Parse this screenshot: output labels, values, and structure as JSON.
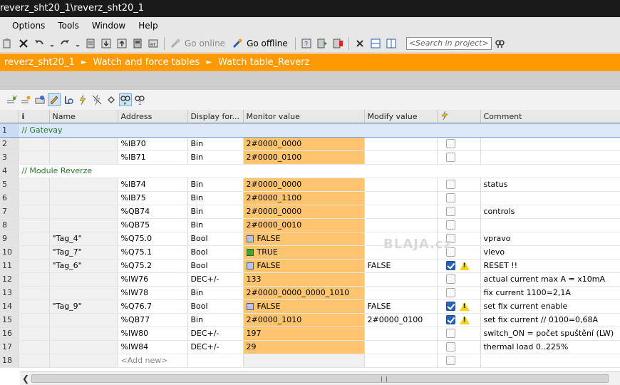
{
  "window": {
    "title": "reverz_sht20_1\\reverz_sht20_1"
  },
  "menu": [
    "Options",
    "Tools",
    "Window",
    "Help"
  ],
  "toolbar": {
    "go_online": "Go online",
    "go_offline": "Go offline",
    "search_placeholder": "<Search in project>"
  },
  "breadcrumb": [
    "reverz_sht20_1",
    "Watch and force tables",
    "Watch table_Reverz"
  ],
  "watermark": "BLAJA.cz",
  "table": {
    "headers": [
      "i",
      "Name",
      "Address",
      "Display for...",
      "Monitor value",
      "Modify value",
      "",
      "Comment"
    ],
    "rows": [
      {
        "n": "1",
        "group": "// Gatevay"
      },
      {
        "n": "2",
        "name": "",
        "address": "%IB70",
        "display": "Bin",
        "monitor": "2#0000_0000",
        "bool": "",
        "modify": "",
        "checked": false,
        "warn": false,
        "comment": ""
      },
      {
        "n": "3",
        "name": "",
        "address": "%IB71",
        "display": "Bin",
        "monitor": "2#0000_0100",
        "bool": "",
        "modify": "",
        "checked": false,
        "warn": false,
        "comment": ""
      },
      {
        "n": "4",
        "group": "// Module Reverze"
      },
      {
        "n": "5",
        "name": "",
        "address": "%IB74",
        "display": "Bin",
        "monitor": "2#0000_0000",
        "bool": "",
        "modify": "",
        "checked": false,
        "warn": false,
        "comment": "status"
      },
      {
        "n": "6",
        "name": "",
        "address": "%IB75",
        "display": "Bin",
        "monitor": "2#0000_1100",
        "bool": "",
        "modify": "",
        "checked": false,
        "warn": false,
        "comment": ""
      },
      {
        "n": "7",
        "name": "",
        "address": "%QB74",
        "display": "Bin",
        "monitor": "2#0000_0000",
        "bool": "",
        "modify": "",
        "checked": false,
        "warn": false,
        "comment": "controls"
      },
      {
        "n": "8",
        "name": "",
        "address": "%QB75",
        "display": "Bin",
        "monitor": "2#0000_0010",
        "bool": "",
        "modify": "",
        "checked": false,
        "warn": false,
        "comment": ""
      },
      {
        "n": "9",
        "name": "\"Tag_4\"",
        "address": "%Q75.0",
        "display": "Bool",
        "monitor": "FALSE",
        "bool": "false",
        "modify": "",
        "checked": false,
        "warn": false,
        "comment": "vpravo"
      },
      {
        "n": "10",
        "name": "\"Tag_7\"",
        "address": "%Q75.1",
        "display": "Bool",
        "monitor": "TRUE",
        "bool": "true",
        "modify": "",
        "checked": false,
        "warn": false,
        "comment": "vlevo"
      },
      {
        "n": "11",
        "name": "\"Tag_6\"",
        "address": "%Q75.2",
        "display": "Bool",
        "monitor": "FALSE",
        "bool": "false",
        "modify": "FALSE",
        "checked": true,
        "warn": true,
        "comment": "RESET !!"
      },
      {
        "n": "12",
        "name": "",
        "address": "%IW76",
        "display": "DEC+/-",
        "monitor": "133",
        "bool": "",
        "modify": "",
        "checked": false,
        "warn": false,
        "comment": "actual current max A = x10mA"
      },
      {
        "n": "13",
        "name": "",
        "address": "%IW78",
        "display": "Bin",
        "monitor": "2#0000_0000_0000_1010",
        "bool": "",
        "modify": "",
        "checked": false,
        "warn": false,
        "comment": "fix current 1100=2,1A"
      },
      {
        "n": "14",
        "name": "\"Tag_9\"",
        "address": "%Q76.7",
        "display": "Bool",
        "monitor": "FALSE",
        "bool": "false",
        "modify": "FALSE",
        "checked": true,
        "warn": true,
        "comment": "set fix current enable"
      },
      {
        "n": "15",
        "name": "",
        "address": "%QB77",
        "display": "Bin",
        "monitor": "2#0000_1010",
        "bool": "",
        "modify": "2#0000_0100",
        "checked": true,
        "warn": true,
        "comment": "set fix current // 0100=0,68A"
      },
      {
        "n": "16",
        "name": "",
        "address": "%IW80",
        "display": "DEC+/-",
        "monitor": "197",
        "bool": "",
        "modify": "",
        "checked": false,
        "warn": false,
        "comment": "switch_ON = počet spuštění (LW)"
      },
      {
        "n": "17",
        "name": "",
        "address": "%IW84",
        "display": "DEC+/-",
        "monitor": "29",
        "bool": "",
        "modify": "",
        "checked": false,
        "warn": false,
        "comment": "thermal load 0..225%"
      },
      {
        "n": "18",
        "name": "",
        "address": "<Add new>",
        "display": "",
        "monitor": "",
        "bool": "",
        "modify": "",
        "checked": false,
        "warn": false,
        "comment": "",
        "addnew": true
      }
    ]
  }
}
